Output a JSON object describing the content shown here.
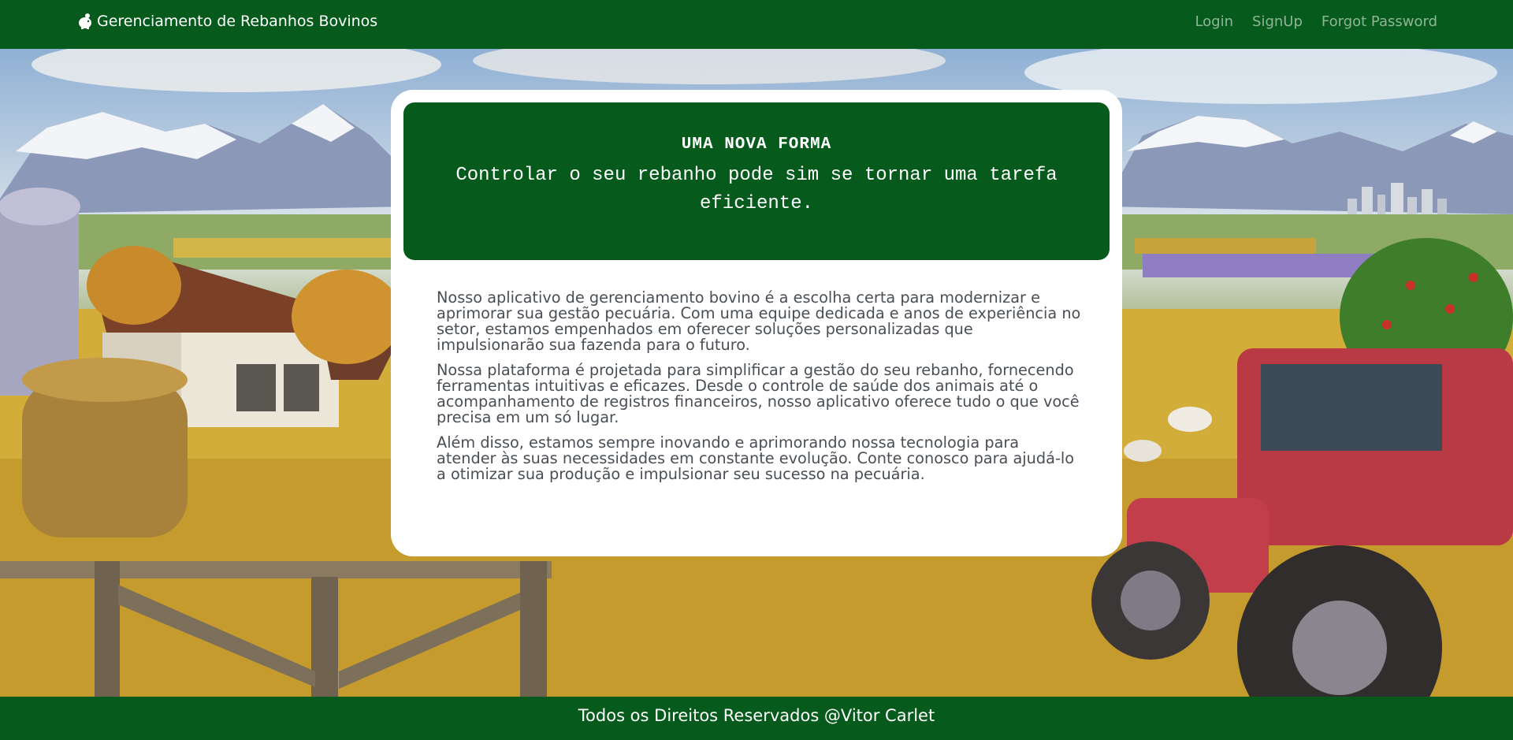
{
  "navbar": {
    "brand_icon": "piggy-bank-icon",
    "brand_label": "Gerenciamento de Rebanhos Bovinos",
    "links": [
      {
        "label": "Login"
      },
      {
        "label": "SignUp"
      },
      {
        "label": "Forgot Password"
      }
    ]
  },
  "hero": {
    "background": "farm-landscape-illustration"
  },
  "card": {
    "banner_title": "UMA NOVA FORMA",
    "banner_subtitle": "Controlar o seu rebanho pode sim se tornar uma tarefa eficiente.",
    "paragraphs": [
      "Nosso aplicativo de gerenciamento bovino é a escolha certa para modernizar e aprimorar sua gestão pecuária. Com uma equipe dedicada e anos de experiência no setor, estamos empenhados em oferecer soluções personalizadas que impulsionarão sua fazenda para o futuro.",
      "Nossa plataforma é projetada para simplificar a gestão do seu rebanho, fornecendo ferramentas intuitivas e eficazes. Desde o controle de saúde dos animais até o acompanhamento de registros financeiros, nosso aplicativo oferece tudo o que você precisa em um só lugar.",
      "Além disso, estamos sempre inovando e aprimorando nossa tecnologia para atender às suas necessidades em constante evolução. Conte conosco para ajudá-lo a otimizar sua produção e impulsionar seu sucesso na pecuária."
    ]
  },
  "footer": {
    "text": "Todos os Direitos Reservados @Vitor Carlet"
  },
  "colors": {
    "primary_green": "#065a1b",
    "text_gray": "#4a4e55",
    "nav_link": "rgba(255,255,255,0.55)"
  }
}
